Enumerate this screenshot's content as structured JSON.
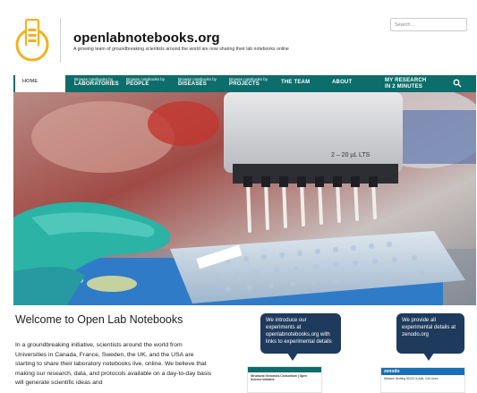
{
  "header": {
    "site_title": "openlabnotebooks.org",
    "tagline": "A growing team of groundbreaking scientists around the world are now sharing their lab notebooks online",
    "search_placeholder": "Search..."
  },
  "nav": {
    "home": "HOME",
    "items": [
      {
        "small": "Browse notebooks by",
        "big": "LABORATORIES"
      },
      {
        "small": "Browse notebooks by",
        "big": "PEOPLE"
      },
      {
        "small": "Browse notebooks by",
        "big": "DISEASES"
      },
      {
        "small": "Browse notebooks by",
        "big": "PROJECTS"
      },
      {
        "small": "",
        "big": "THE TEAM"
      },
      {
        "small": "",
        "big": "ABOUT"
      },
      {
        "small": "MY RESEARCH",
        "big": "IN 2 MINUTES"
      }
    ],
    "search_icon": "search-icon"
  },
  "hero": {
    "pipette_label": "2 – 20 µL LTS"
  },
  "main": {
    "welcome_title": "Welcome to Open Lab Notebooks",
    "intro_text": "In a groundbreaking initiative, scientists around the world from Universities in Canada, France, Sweden, the UK, and the USA are starting to share their laboratory notebooks live, online. We believe that making our research, data, and protocols available on a day-to-day basis will generate scientific ideas and"
  },
  "bubbles": {
    "left": "We introduce our experiments at openlabnotebooks.org with links to experimental details",
    "right": "We provide all experimental details at zenodo.org"
  },
  "thumbs": {
    "left_title": "Structural Genomics Consortium | Open Science Initiative",
    "right_logo": "zenodo",
    "right_title": "Western Blotting NDG3 in AML Cell Lines"
  },
  "colors": {
    "nav_teal": "#0c6d6b",
    "bubble_navy": "#1e3a5c",
    "logo_orange": "#f2b21f"
  }
}
